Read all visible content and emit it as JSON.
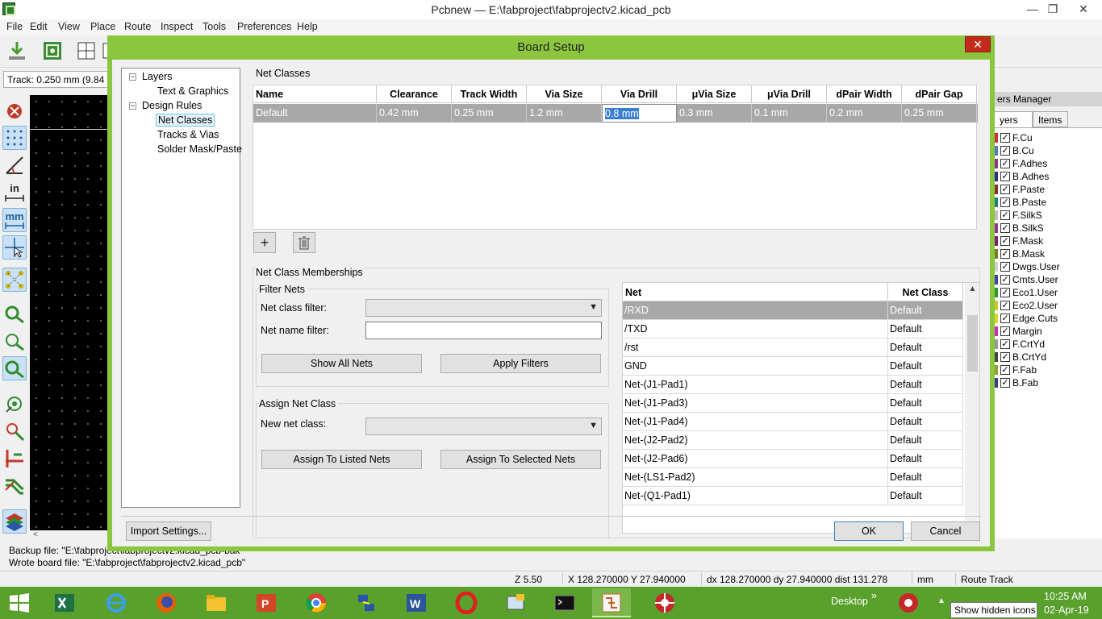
{
  "window": {
    "title": "Pcbnew — E:\\fabproject\\fabprojectv2.kicad_pcb",
    "minimize": "—",
    "maximize": "❐",
    "close": "✕"
  },
  "menu": [
    "File",
    "Edit",
    "View",
    "Place",
    "Route",
    "Inspect",
    "Tools",
    "Preferences",
    "Help"
  ],
  "aux_toolbar": {
    "track": "Track: 0.250 mm (9.84 m"
  },
  "left_toolbar": {
    "in_label": "in",
    "mm_label": "mm"
  },
  "messages": {
    "line1": "Backup file: \"E:\\fabproject\\fabprojectv2.kicad_pcb-bak\"",
    "line2": "Wrote board file: \"E:\\fabproject\\fabprojectv2.kicad_pcb\""
  },
  "status": {
    "zoom": "Z 5.50",
    "xy": "X 128.270000  Y 27.940000",
    "delta": "dx 128.270000  dy 27.940000  dist 131.278",
    "units": "mm",
    "mode": "Route Track"
  },
  "layers_panel": {
    "title": "ers Manager",
    "tab_layers": "yers",
    "tab_items": "Items",
    "layers": [
      {
        "name": "F.Cu",
        "color": "#c83434"
      },
      {
        "name": "B.Cu",
        "color": "#4d7fc4"
      },
      {
        "name": "F.Adhes",
        "color": "#8b3a8b"
      },
      {
        "name": "B.Adhes",
        "color": "#2a2a9a"
      },
      {
        "name": "F.Paste",
        "color": "#8a2f2f"
      },
      {
        "name": "B.Paste",
        "color": "#1f7f7f"
      },
      {
        "name": "F.SilkS",
        "color": "#c0c0c0"
      },
      {
        "name": "B.SilkS",
        "color": "#9a2fa0"
      },
      {
        "name": "F.Mask",
        "color": "#7a1f7a"
      },
      {
        "name": "B.Mask",
        "color": "#7a7a1f"
      },
      {
        "name": "Dwgs.User",
        "color": "#d0d0d0"
      },
      {
        "name": "Cmts.User",
        "color": "#3f3fb0"
      },
      {
        "name": "Eco1.User",
        "color": "#2f9a2f"
      },
      {
        "name": "Eco2.User",
        "color": "#c8c82f"
      },
      {
        "name": "Edge.Cuts",
        "color": "#d8d82f"
      },
      {
        "name": "Margin",
        "color": "#c82fc8"
      },
      {
        "name": "F.CrtYd",
        "color": "#9a9a9a"
      },
      {
        "name": "B.CrtYd",
        "color": "#444444"
      },
      {
        "name": "F.Fab",
        "color": "#9a9a3a"
      },
      {
        "name": "B.Fab",
        "color": "#3a3a9a"
      }
    ]
  },
  "dialog": {
    "title": "Board Setup",
    "close": "✕",
    "tree": {
      "layers": "Layers",
      "text_graphics": "Text & Graphics",
      "design_rules": "Design Rules",
      "net_classes": "Net Classes",
      "tracks_vias": "Tracks & Vias",
      "solder_mask": "Solder Mask/Paste"
    },
    "net_classes": {
      "label": "Net Classes",
      "columns": [
        "Name",
        "Clearance",
        "Track Width",
        "Via Size",
        "Via Drill",
        "μVia Size",
        "μVia Drill",
        "dPair Width",
        "dPair Gap"
      ],
      "rows": [
        [
          "Default",
          "0.42 mm",
          "0.25 mm",
          "1.2 mm",
          "0.8 mm",
          "0.3 mm",
          "0.1 mm",
          "0.2 mm",
          "0.25 mm"
        ]
      ],
      "add": "+",
      "delete": "🗑"
    },
    "memberships": {
      "label": "Net Class Memberships",
      "filter_label": "Filter Nets",
      "class_filter_label": "Net class filter:",
      "class_filter_value": "",
      "name_filter_label": "Net name filter:",
      "name_filter_value": "",
      "show_all": "Show All Nets",
      "apply_filters": "Apply Filters",
      "assign_label": "Assign Net Class",
      "new_class_label": "New net class:",
      "new_class_value": "",
      "assign_listed": "Assign To Listed Nets",
      "assign_selected": "Assign To Selected Nets",
      "net_header": "Net",
      "class_header": "Net Class",
      "nets": [
        {
          "net": "/RXD",
          "cls": "Default"
        },
        {
          "net": "/TXD",
          "cls": "Default"
        },
        {
          "net": "/rst",
          "cls": "Default"
        },
        {
          "net": "GND",
          "cls": "Default"
        },
        {
          "net": "Net-(J1-Pad1)",
          "cls": "Default"
        },
        {
          "net": "Net-(J1-Pad3)",
          "cls": "Default"
        },
        {
          "net": "Net-(J1-Pad4)",
          "cls": "Default"
        },
        {
          "net": "Net-(J2-Pad2)",
          "cls": "Default"
        },
        {
          "net": "Net-(J2-Pad6)",
          "cls": "Default"
        },
        {
          "net": "Net-(LS1-Pad2)",
          "cls": "Default"
        },
        {
          "net": "Net-(Q1-Pad1)",
          "cls": "Default"
        }
      ]
    },
    "import_settings": "Import Settings...",
    "ok": "OK",
    "cancel": "Cancel"
  },
  "taskbar": {
    "desktop": "Desktop",
    "chevron": "»",
    "time": "10:25 AM",
    "date": "02-Apr-19",
    "tooltip": "Show hidden icons",
    "show_hidden": "▲"
  }
}
